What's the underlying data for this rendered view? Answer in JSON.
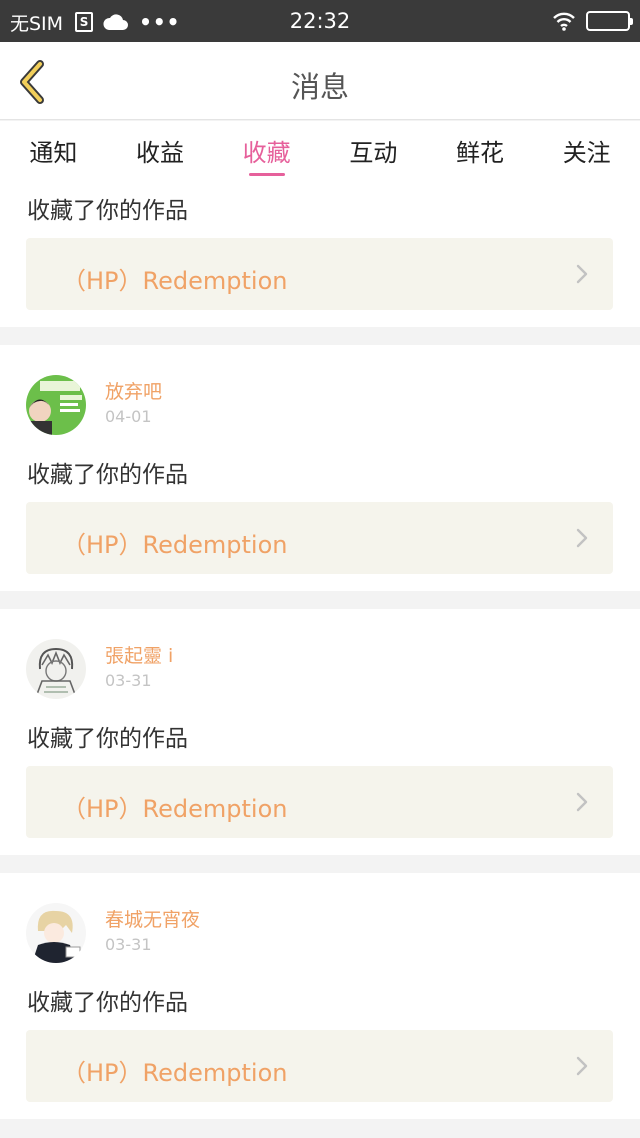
{
  "status_bar": {
    "carrier": "无SIM",
    "s_icon": "S",
    "icons": [
      "s-icon",
      "cloud-icon",
      "more-icon",
      "wifi-icon",
      "battery-icon"
    ],
    "more": "•••",
    "time": "22:32"
  },
  "nav": {
    "title": "消息",
    "back_icon": "chevron-left-icon"
  },
  "tabs": [
    {
      "label": "通知",
      "active": false
    },
    {
      "label": "收益",
      "active": false
    },
    {
      "label": "收藏",
      "active": true
    },
    {
      "label": "互动",
      "active": false
    },
    {
      "label": "鲜花",
      "active": false
    },
    {
      "label": "关注",
      "active": false
    }
  ],
  "feed": {
    "items": [
      {
        "action": "收藏了你的作品",
        "work_title": "（HP）Redemption"
      },
      {
        "username": "放弃吧",
        "date": "04-01",
        "action": "收藏了你的作品",
        "work_title": "（HP）Redemption"
      },
      {
        "username": "張起靈 i",
        "date": "03-31",
        "action": "收藏了你的作品",
        "work_title": "（HP）Redemption"
      },
      {
        "username": "春城无宵夜",
        "date": "03-31",
        "action": "收藏了你的作品",
        "work_title": "（HP）Redemption"
      }
    ]
  },
  "colors": {
    "accent_pink": "#e6609b",
    "username_orange": "#f0a266",
    "status_bar_bg": "#3a3a3a",
    "link_bg": "#f5f4ec"
  }
}
